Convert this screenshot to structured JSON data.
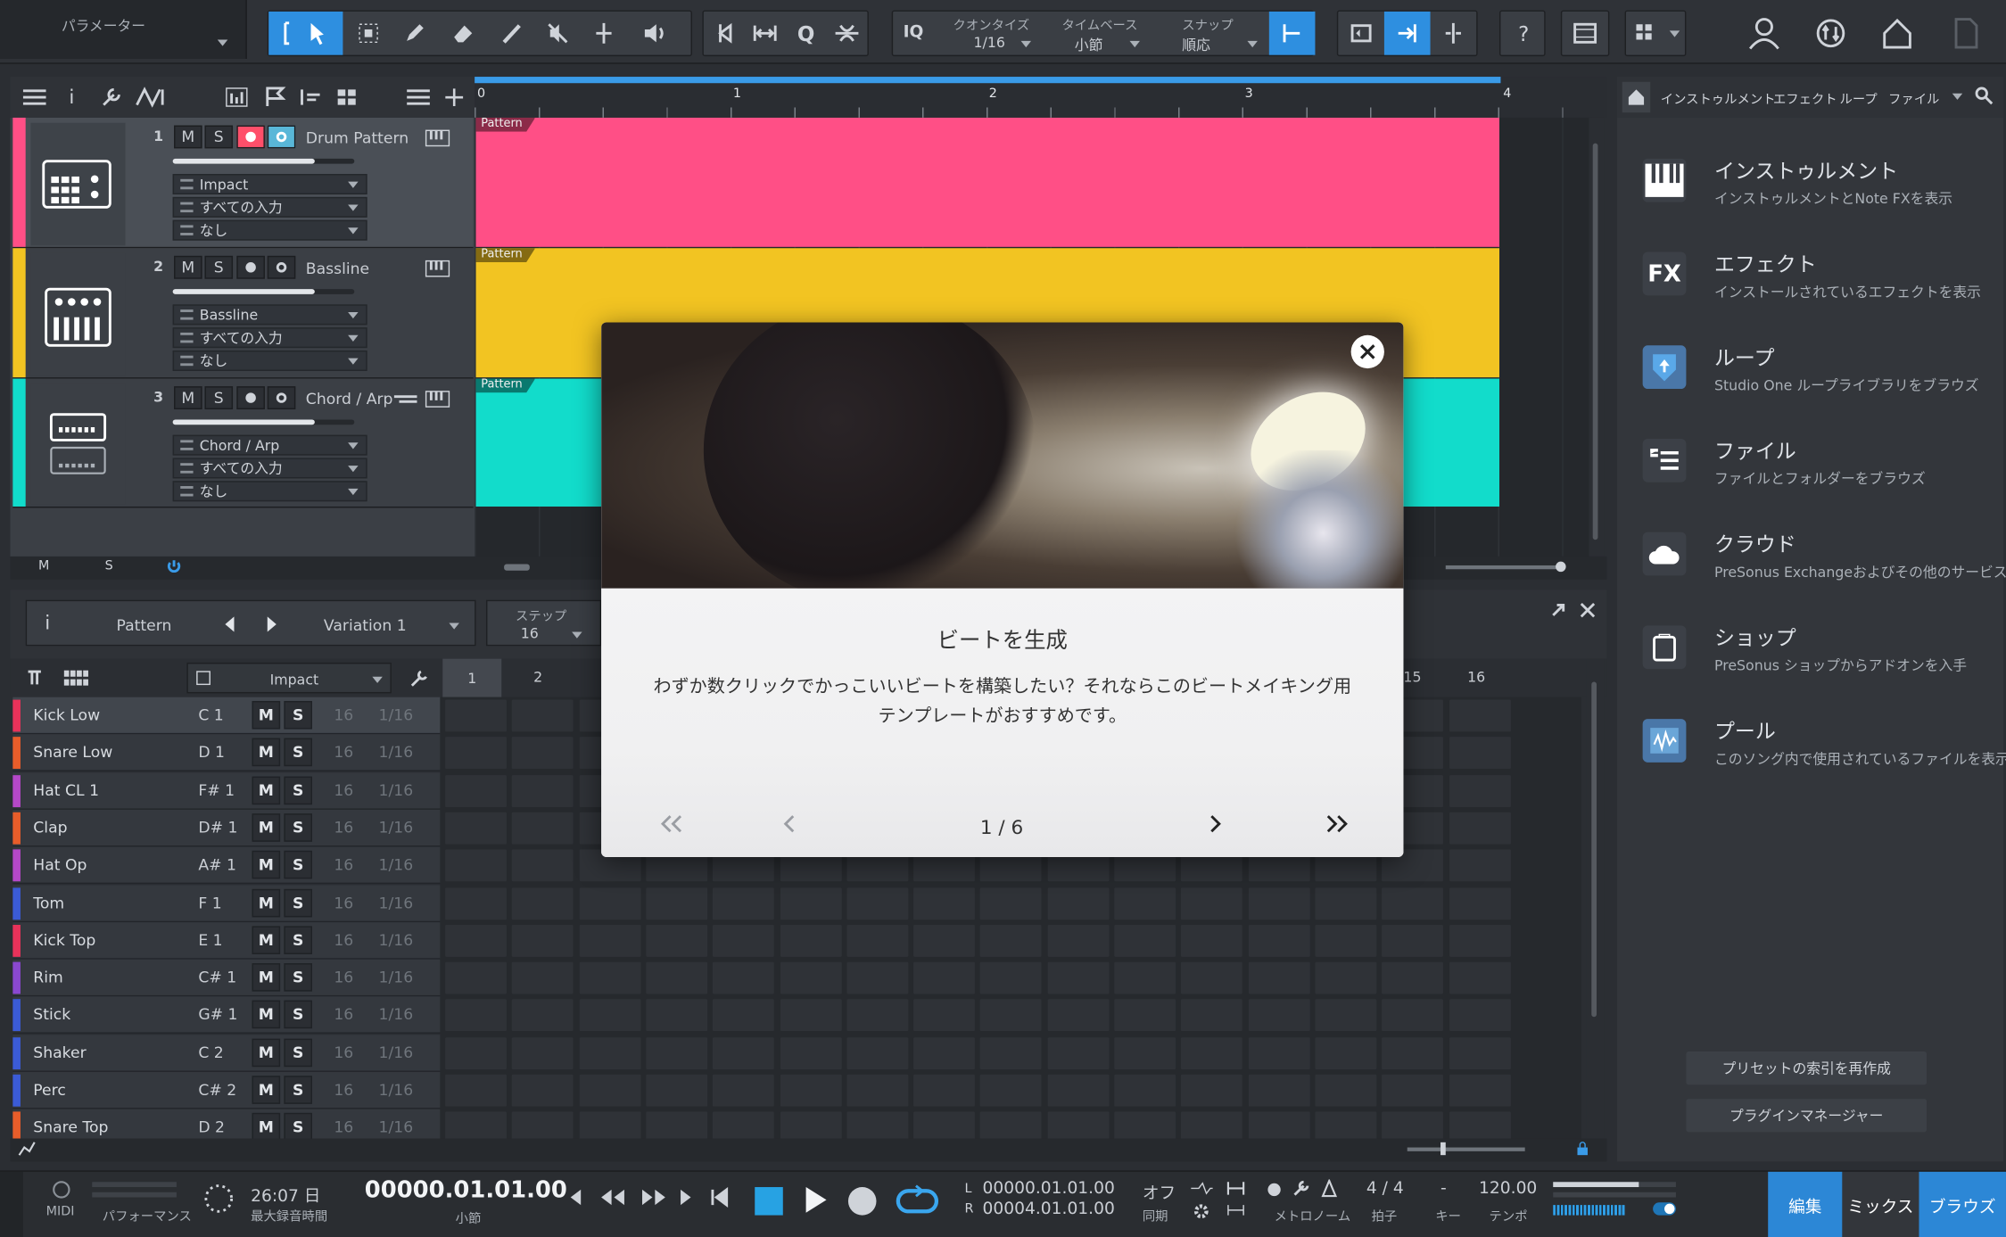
{
  "toolbar": {
    "parameter_label": "パラメーター",
    "iq": "IQ",
    "quantize": {
      "label": "クオンタイズ",
      "value": "1/16"
    },
    "timebase": {
      "label": "タイムベース",
      "value": "小節"
    },
    "snap": {
      "label": "スナップ",
      "value": "順応"
    },
    "help": "?"
  },
  "track_toolbar": {
    "m": "M",
    "s": "S"
  },
  "ruler": {
    "marks": [
      "0",
      "1",
      "2",
      "3",
      "4"
    ]
  },
  "tracks": [
    {
      "num": "1",
      "m": "M",
      "s": "S",
      "name": "Drum Pattern",
      "instrument": "Impact",
      "input": "すべての入力",
      "output": "なし",
      "color": "#ff4f86",
      "pattern": "Pattern"
    },
    {
      "num": "2",
      "m": "M",
      "s": "S",
      "name": "Bassline",
      "instrument": "Bassline",
      "input": "すべての入力",
      "output": "なし",
      "color": "#f2c422",
      "pattern": "Pattern"
    },
    {
      "num": "3",
      "m": "M",
      "s": "S",
      "name": "Chord / Arp",
      "instrument": "Chord / Arp",
      "input": "すべての入力",
      "output": "なし",
      "color": "#12dccb",
      "pattern": "Pattern"
    }
  ],
  "editor": {
    "info": "i",
    "pattern": "Pattern",
    "variation": "Variation 1",
    "step_label": "ステップ",
    "step_value": "16",
    "instrument": "Impact",
    "steps": [
      "1",
      "2",
      "15",
      "16"
    ]
  },
  "drum_rows": [
    {
      "name": "Kick Low",
      "note": "C 1",
      "color": "#e8325a",
      "m": "M",
      "s": "S",
      "v1": "16",
      "v2": "1/16"
    },
    {
      "name": "Snare Low",
      "note": "D 1",
      "color": "#e85d2a",
      "m": "M",
      "s": "S",
      "v1": "16",
      "v2": "1/16"
    },
    {
      "name": "Hat CL 1",
      "note": "F# 1",
      "color": "#b548c8",
      "m": "M",
      "s": "S",
      "v1": "16",
      "v2": "1/16"
    },
    {
      "name": "Clap",
      "note": "D# 1",
      "color": "#e85d2a",
      "m": "M",
      "s": "S",
      "v1": "16",
      "v2": "1/16"
    },
    {
      "name": "Hat Op",
      "note": "A# 1",
      "color": "#b548c8",
      "m": "M",
      "s": "S",
      "v1": "16",
      "v2": "1/16"
    },
    {
      "name": "Tom",
      "note": "F 1",
      "color": "#3b5bd6",
      "m": "M",
      "s": "S",
      "v1": "16",
      "v2": "1/16"
    },
    {
      "name": "Kick Top",
      "note": "E 1",
      "color": "#e8325a",
      "m": "M",
      "s": "S",
      "v1": "16",
      "v2": "1/16"
    },
    {
      "name": "Rim",
      "note": "C# 1",
      "color": "#8a48d0",
      "m": "M",
      "s": "S",
      "v1": "16",
      "v2": "1/16"
    },
    {
      "name": "Stick",
      "note": "G# 1",
      "color": "#3b5bd6",
      "m": "M",
      "s": "S",
      "v1": "16",
      "v2": "1/16"
    },
    {
      "name": "Shaker",
      "note": "C 2",
      "color": "#3b5bd6",
      "m": "M",
      "s": "S",
      "v1": "16",
      "v2": "1/16"
    },
    {
      "name": "Perc",
      "note": "C# 2",
      "color": "#3b5bd6",
      "m": "M",
      "s": "S",
      "v1": "16",
      "v2": "1/16"
    },
    {
      "name": "Snare Top",
      "note": "D 2",
      "color": "#e85d2a",
      "m": "M",
      "s": "S",
      "v1": "16",
      "v2": "1/16"
    }
  ],
  "browser": {
    "tabs": [
      "インストゥルメント",
      "エフェクト",
      "ループ",
      "ファイル"
    ],
    "items": [
      {
        "title": "インストゥルメント",
        "desc": "インストゥルメントとNote FXを表示",
        "icon": "piano-icon"
      },
      {
        "title": "エフェクト",
        "desc": "インストールされているエフェクトを表示",
        "icon": "fx-icon"
      },
      {
        "title": "ループ",
        "desc": "Studio One ループライブラリをブラウズ",
        "icon": "loop-icon"
      },
      {
        "title": "ファイル",
        "desc": "ファイルとフォルダーをブラウズ",
        "icon": "file-list-icon"
      },
      {
        "title": "クラウド",
        "desc": "PreSonus Exchangeおよびその他のサービス",
        "icon": "cloud-icon"
      },
      {
        "title": "ショップ",
        "desc": "PreSonus ショップからアドオンを入手",
        "icon": "shop-icon"
      },
      {
        "title": "プール",
        "desc": "このソング内で使用されているファイルを表示",
        "icon": "pool-icon"
      }
    ],
    "fx_label": "FX",
    "rebuild": "プリセットの索引を再作成",
    "plugin_manager": "プラグインマネージャー"
  },
  "modal": {
    "title": "ビートを生成",
    "body": "わずか数クリックでかっこいいビートを構築したい？それならこのビートメイキング用テンプレートがおすすめです。",
    "page": "1 / 6"
  },
  "transport": {
    "midi": "MIDI",
    "performance": "パフォーマンス",
    "record_time": "26:07 日",
    "record_time_label": "最大録音時間",
    "position": "00000.01.01.00",
    "position_unit": "小節",
    "loop_l": "00000.01.01.00",
    "loop_r": "00004.01.01.00",
    "l": "L",
    "r": "R",
    "sync": "オフ",
    "sync_label": "同期",
    "metronome": "メトロノーム",
    "time_sig": "4 / 4",
    "time_sig_label": "拍子",
    "key": "-",
    "key_label": "キー",
    "tempo": "120.00",
    "tempo_label": "テンポ"
  },
  "view_tabs": {
    "edit": "編集",
    "mix": "ミックス",
    "browse": "ブラウズ"
  },
  "colors": {
    "accent": "#2e8fe0",
    "drum": "#ff4f86",
    "bass": "#f2c422",
    "chord": "#12dccb"
  }
}
